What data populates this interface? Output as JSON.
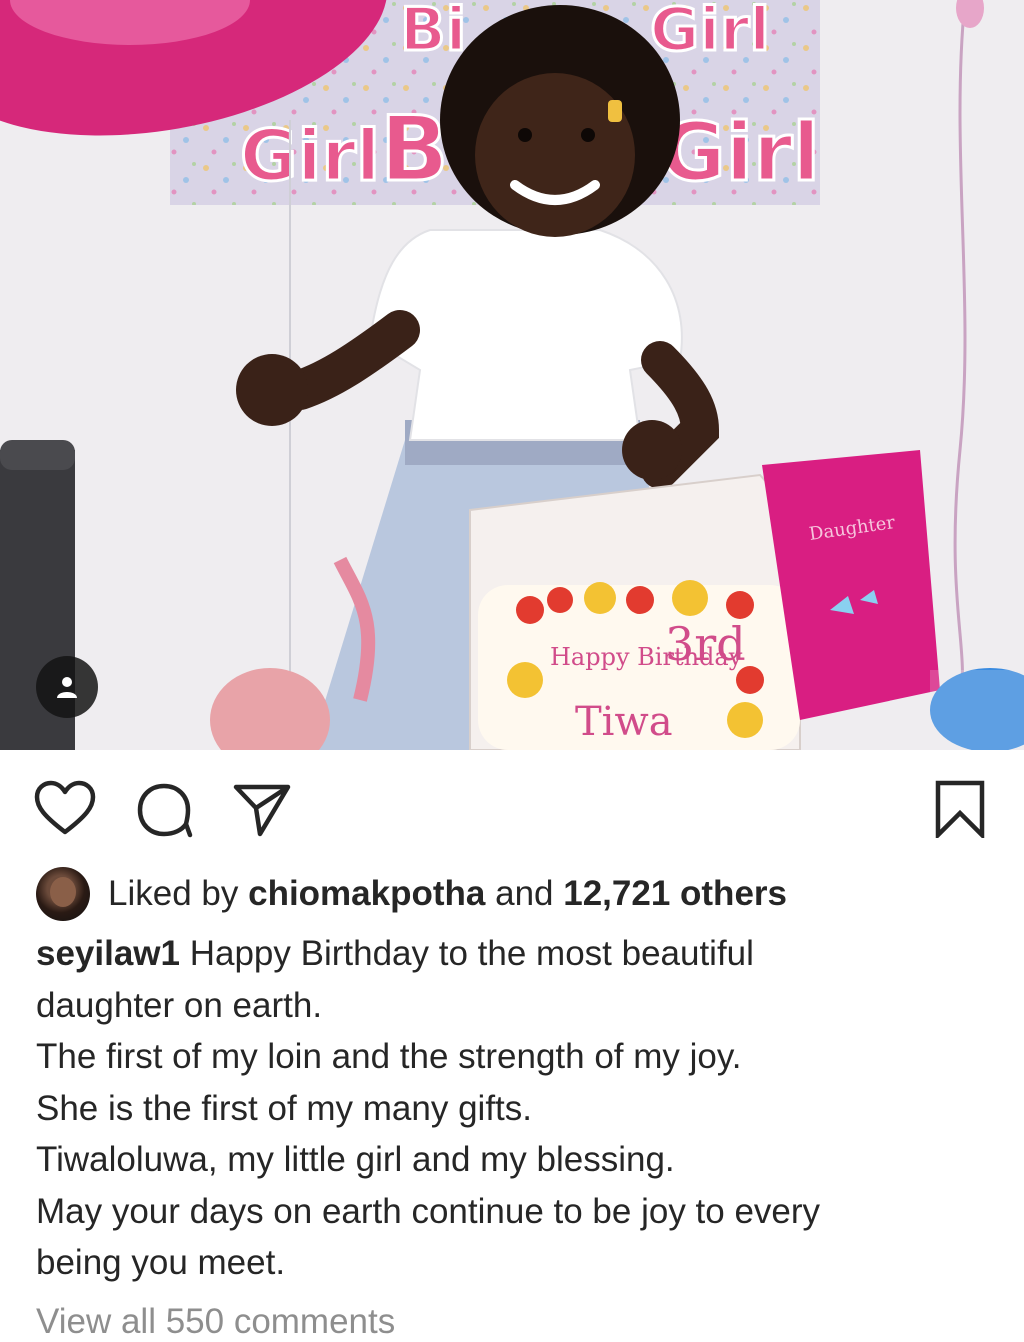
{
  "post": {
    "photo_banner_words": [
      "Birthday Girl",
      "Girl",
      "Birthday Girl"
    ],
    "cake_text": [
      "Happy Birthday",
      "3rd",
      "Tiwa"
    ],
    "card_text": "Daughter"
  },
  "actions": {
    "like_icon": "heart-icon",
    "comment_icon": "comment-icon",
    "share_icon": "send-icon",
    "save_icon": "bookmark-icon"
  },
  "likes": {
    "prefix": "Liked by ",
    "user": "chiomakpotha",
    "middle": " and ",
    "count": "12,721 others"
  },
  "caption": {
    "username": "seyilaw1",
    "first_line": " Happy Birthday to the most beautiful",
    "lines": [
      "daughter on earth.",
      "The first of my loin and the strength of my joy.",
      "She is the first of my many gifts.",
      "Tiwaloluwa, my little girl and my blessing.",
      "May your days on earth continue to be joy to every",
      "being you meet."
    ]
  },
  "comments": {
    "view_all": "View all 550 comments"
  }
}
